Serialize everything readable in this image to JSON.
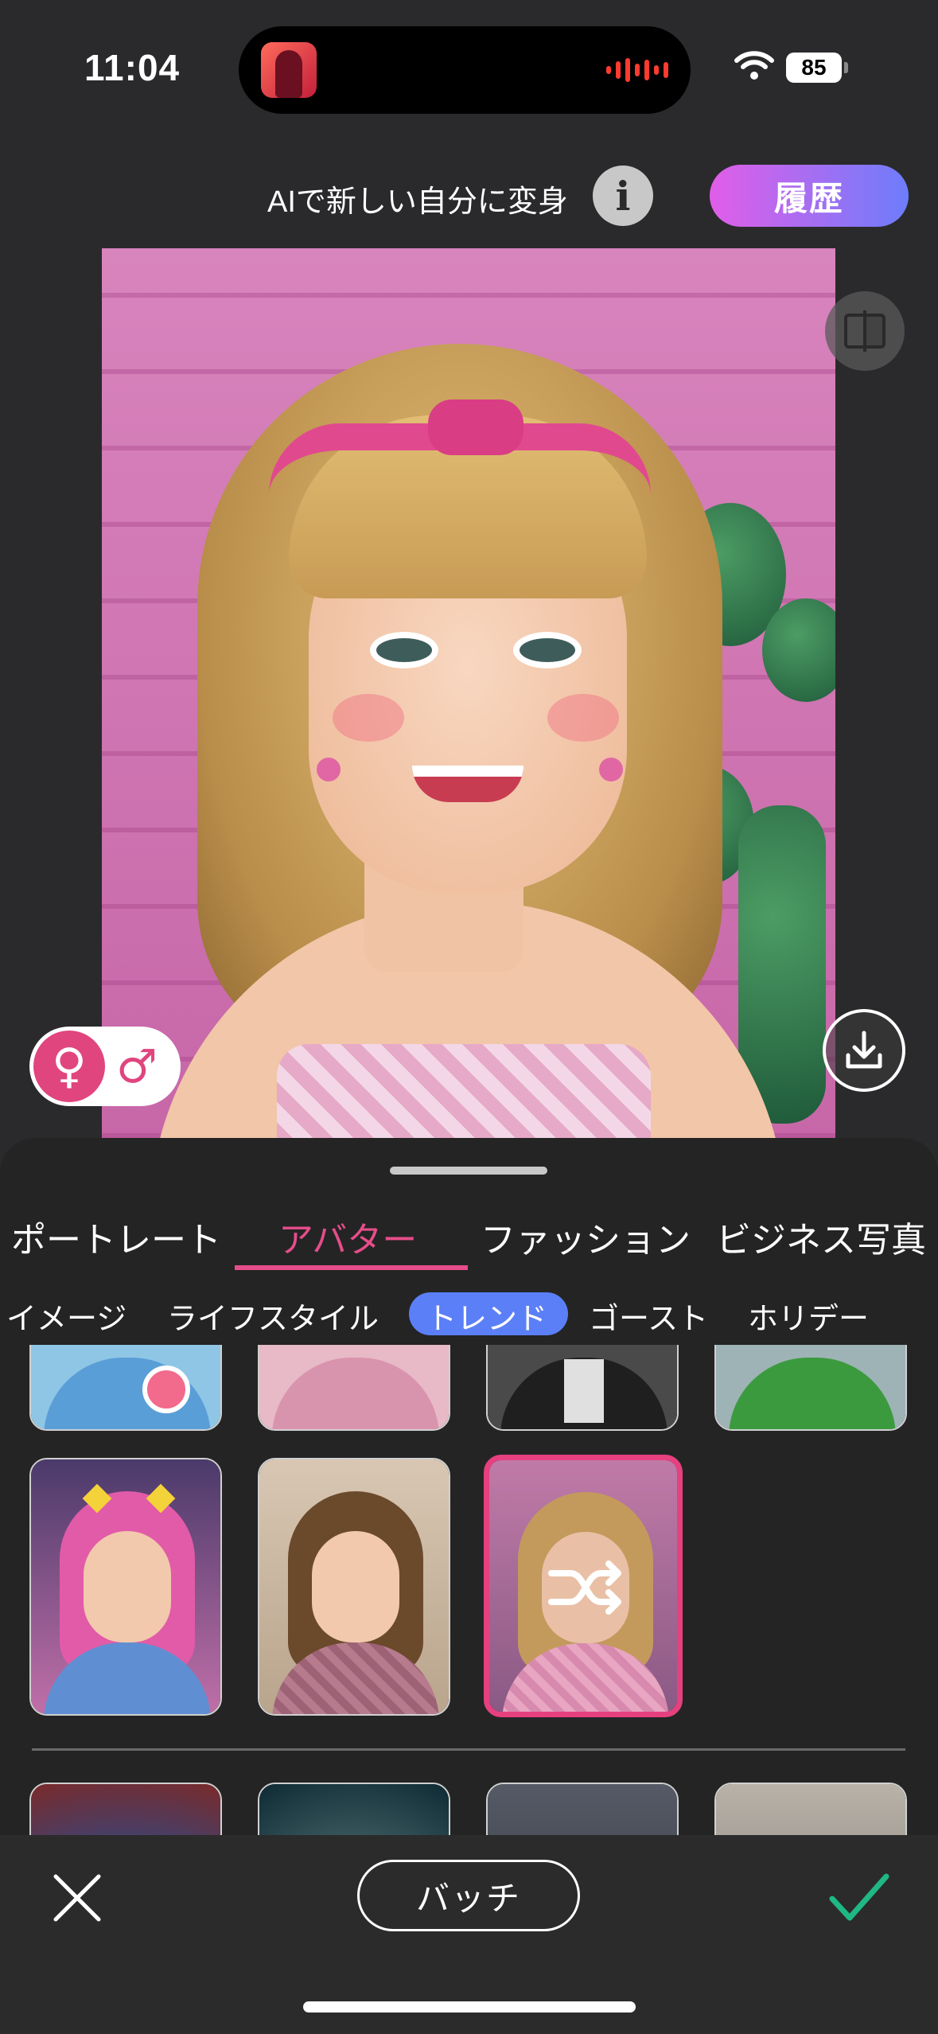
{
  "status_bar": {
    "time": "11:04",
    "battery": "85"
  },
  "header": {
    "title": "AIで新しい自分に変身",
    "info_label": "i",
    "history_label": "履歴"
  },
  "preview": {
    "gender_female_symbol": "♀",
    "gender_male_symbol": "♂",
    "selected_gender": "female"
  },
  "category_tabs": [
    {
      "label": "ポートレート",
      "active": false
    },
    {
      "label": "アバター",
      "active": true
    },
    {
      "label": "ファッション",
      "active": false
    },
    {
      "label": "ビジネス写真",
      "active": false
    }
  ],
  "sub_tabs": [
    {
      "label": "イメージ",
      "active": false
    },
    {
      "label": "ライフスタイル",
      "active": false
    },
    {
      "label": "トレンド",
      "active": true
    },
    {
      "label": "ゴースト",
      "active": false
    },
    {
      "label": "ホリデー",
      "active": false
    }
  ],
  "bottom_bar": {
    "batch_label": "バッチ"
  },
  "colors": {
    "accent_pink": "#e64d8a",
    "pill_blue": "#5b7ff7",
    "confirm_green": "#1fb783",
    "history_gradient": [
      "#e15ee8",
      "#6d7dfb"
    ]
  }
}
